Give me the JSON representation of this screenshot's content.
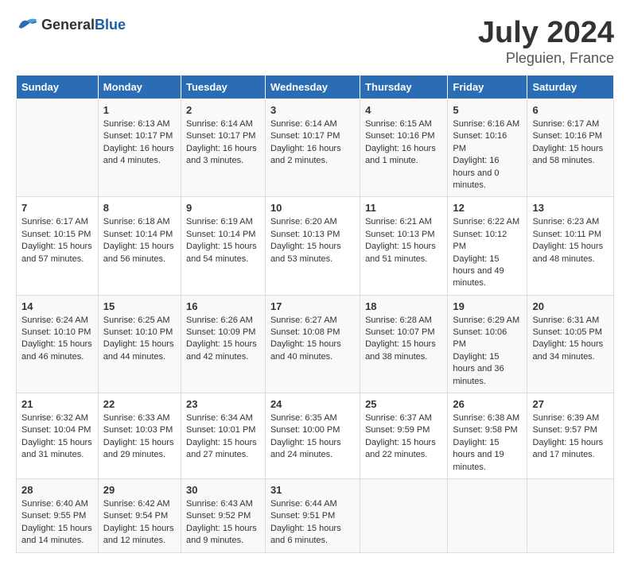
{
  "header": {
    "logo_general": "General",
    "logo_blue": "Blue",
    "month_year": "July 2024",
    "location": "Pleguien, France"
  },
  "days_of_week": [
    "Sunday",
    "Monday",
    "Tuesday",
    "Wednesday",
    "Thursday",
    "Friday",
    "Saturday"
  ],
  "weeks": [
    [
      {
        "day": "",
        "sunrise": "",
        "sunset": "",
        "daylight": ""
      },
      {
        "day": "1",
        "sunrise": "Sunrise: 6:13 AM",
        "sunset": "Sunset: 10:17 PM",
        "daylight": "Daylight: 16 hours and 4 minutes."
      },
      {
        "day": "2",
        "sunrise": "Sunrise: 6:14 AM",
        "sunset": "Sunset: 10:17 PM",
        "daylight": "Daylight: 16 hours and 3 minutes."
      },
      {
        "day": "3",
        "sunrise": "Sunrise: 6:14 AM",
        "sunset": "Sunset: 10:17 PM",
        "daylight": "Daylight: 16 hours and 2 minutes."
      },
      {
        "day": "4",
        "sunrise": "Sunrise: 6:15 AM",
        "sunset": "Sunset: 10:16 PM",
        "daylight": "Daylight: 16 hours and 1 minute."
      },
      {
        "day": "5",
        "sunrise": "Sunrise: 6:16 AM",
        "sunset": "Sunset: 10:16 PM",
        "daylight": "Daylight: 16 hours and 0 minutes."
      },
      {
        "day": "6",
        "sunrise": "Sunrise: 6:17 AM",
        "sunset": "Sunset: 10:16 PM",
        "daylight": "Daylight: 15 hours and 58 minutes."
      }
    ],
    [
      {
        "day": "7",
        "sunrise": "Sunrise: 6:17 AM",
        "sunset": "Sunset: 10:15 PM",
        "daylight": "Daylight: 15 hours and 57 minutes."
      },
      {
        "day": "8",
        "sunrise": "Sunrise: 6:18 AM",
        "sunset": "Sunset: 10:14 PM",
        "daylight": "Daylight: 15 hours and 56 minutes."
      },
      {
        "day": "9",
        "sunrise": "Sunrise: 6:19 AM",
        "sunset": "Sunset: 10:14 PM",
        "daylight": "Daylight: 15 hours and 54 minutes."
      },
      {
        "day": "10",
        "sunrise": "Sunrise: 6:20 AM",
        "sunset": "Sunset: 10:13 PM",
        "daylight": "Daylight: 15 hours and 53 minutes."
      },
      {
        "day": "11",
        "sunrise": "Sunrise: 6:21 AM",
        "sunset": "Sunset: 10:13 PM",
        "daylight": "Daylight: 15 hours and 51 minutes."
      },
      {
        "day": "12",
        "sunrise": "Sunrise: 6:22 AM",
        "sunset": "Sunset: 10:12 PM",
        "daylight": "Daylight: 15 hours and 49 minutes."
      },
      {
        "day": "13",
        "sunrise": "Sunrise: 6:23 AM",
        "sunset": "Sunset: 10:11 PM",
        "daylight": "Daylight: 15 hours and 48 minutes."
      }
    ],
    [
      {
        "day": "14",
        "sunrise": "Sunrise: 6:24 AM",
        "sunset": "Sunset: 10:10 PM",
        "daylight": "Daylight: 15 hours and 46 minutes."
      },
      {
        "day": "15",
        "sunrise": "Sunrise: 6:25 AM",
        "sunset": "Sunset: 10:10 PM",
        "daylight": "Daylight: 15 hours and 44 minutes."
      },
      {
        "day": "16",
        "sunrise": "Sunrise: 6:26 AM",
        "sunset": "Sunset: 10:09 PM",
        "daylight": "Daylight: 15 hours and 42 minutes."
      },
      {
        "day": "17",
        "sunrise": "Sunrise: 6:27 AM",
        "sunset": "Sunset: 10:08 PM",
        "daylight": "Daylight: 15 hours and 40 minutes."
      },
      {
        "day": "18",
        "sunrise": "Sunrise: 6:28 AM",
        "sunset": "Sunset: 10:07 PM",
        "daylight": "Daylight: 15 hours and 38 minutes."
      },
      {
        "day": "19",
        "sunrise": "Sunrise: 6:29 AM",
        "sunset": "Sunset: 10:06 PM",
        "daylight": "Daylight: 15 hours and 36 minutes."
      },
      {
        "day": "20",
        "sunrise": "Sunrise: 6:31 AM",
        "sunset": "Sunset: 10:05 PM",
        "daylight": "Daylight: 15 hours and 34 minutes."
      }
    ],
    [
      {
        "day": "21",
        "sunrise": "Sunrise: 6:32 AM",
        "sunset": "Sunset: 10:04 PM",
        "daylight": "Daylight: 15 hours and 31 minutes."
      },
      {
        "day": "22",
        "sunrise": "Sunrise: 6:33 AM",
        "sunset": "Sunset: 10:03 PM",
        "daylight": "Daylight: 15 hours and 29 minutes."
      },
      {
        "day": "23",
        "sunrise": "Sunrise: 6:34 AM",
        "sunset": "Sunset: 10:01 PM",
        "daylight": "Daylight: 15 hours and 27 minutes."
      },
      {
        "day": "24",
        "sunrise": "Sunrise: 6:35 AM",
        "sunset": "Sunset: 10:00 PM",
        "daylight": "Daylight: 15 hours and 24 minutes."
      },
      {
        "day": "25",
        "sunrise": "Sunrise: 6:37 AM",
        "sunset": "Sunset: 9:59 PM",
        "daylight": "Daylight: 15 hours and 22 minutes."
      },
      {
        "day": "26",
        "sunrise": "Sunrise: 6:38 AM",
        "sunset": "Sunset: 9:58 PM",
        "daylight": "Daylight: 15 hours and 19 minutes."
      },
      {
        "day": "27",
        "sunrise": "Sunrise: 6:39 AM",
        "sunset": "Sunset: 9:57 PM",
        "daylight": "Daylight: 15 hours and 17 minutes."
      }
    ],
    [
      {
        "day": "28",
        "sunrise": "Sunrise: 6:40 AM",
        "sunset": "Sunset: 9:55 PM",
        "daylight": "Daylight: 15 hours and 14 minutes."
      },
      {
        "day": "29",
        "sunrise": "Sunrise: 6:42 AM",
        "sunset": "Sunset: 9:54 PM",
        "daylight": "Daylight: 15 hours and 12 minutes."
      },
      {
        "day": "30",
        "sunrise": "Sunrise: 6:43 AM",
        "sunset": "Sunset: 9:52 PM",
        "daylight": "Daylight: 15 hours and 9 minutes."
      },
      {
        "day": "31",
        "sunrise": "Sunrise: 6:44 AM",
        "sunset": "Sunset: 9:51 PM",
        "daylight": "Daylight: 15 hours and 6 minutes."
      },
      {
        "day": "",
        "sunrise": "",
        "sunset": "",
        "daylight": ""
      },
      {
        "day": "",
        "sunrise": "",
        "sunset": "",
        "daylight": ""
      },
      {
        "day": "",
        "sunrise": "",
        "sunset": "",
        "daylight": ""
      }
    ]
  ]
}
